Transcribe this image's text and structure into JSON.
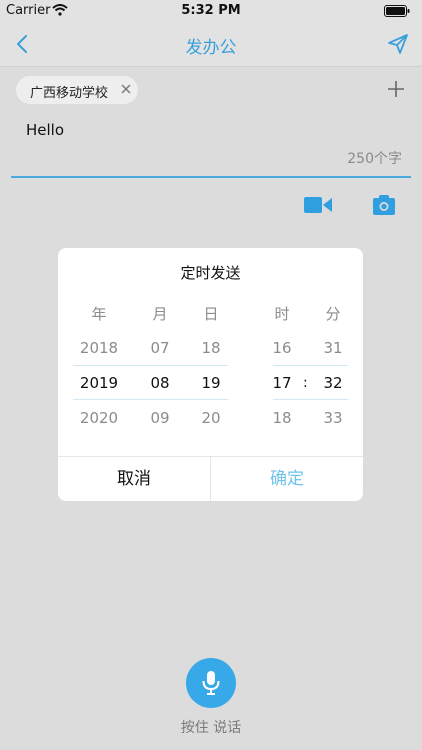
{
  "status_bar": {
    "carrier": "Carrier",
    "time": "5:32 PM"
  },
  "nav": {
    "title": "发办公",
    "accent_color": "#3aa0dc"
  },
  "recipient": {
    "tag_label": "广西移动学校"
  },
  "message": {
    "text": "Hello",
    "char_count": "250个字"
  },
  "dialog": {
    "title": "定时发送",
    "columns": {
      "year": {
        "header": "年",
        "prev": "2018",
        "current": "2019",
        "next": "2020"
      },
      "month": {
        "header": "月",
        "prev": "07",
        "current": "08",
        "next": "09"
      },
      "day": {
        "header": "日",
        "prev": "18",
        "current": "19",
        "next": "20"
      },
      "hour": {
        "header": "时",
        "prev": "16",
        "current": "17",
        "next": "18"
      },
      "minute": {
        "header": "分",
        "prev": "31",
        "current": "32",
        "next": "33"
      }
    },
    "time_separator": ":",
    "cancel_label": "取消",
    "confirm_label": "确定"
  },
  "voice": {
    "label": "按住 说话"
  },
  "icons": {
    "back": "chevron-left-icon",
    "send": "paper-plane-icon",
    "add": "plus-icon",
    "close": "close-icon",
    "video": "video-camera-icon",
    "camera": "camera-icon",
    "mic": "microphone-icon",
    "wifi": "wifi-icon",
    "battery": "battery-icon"
  }
}
